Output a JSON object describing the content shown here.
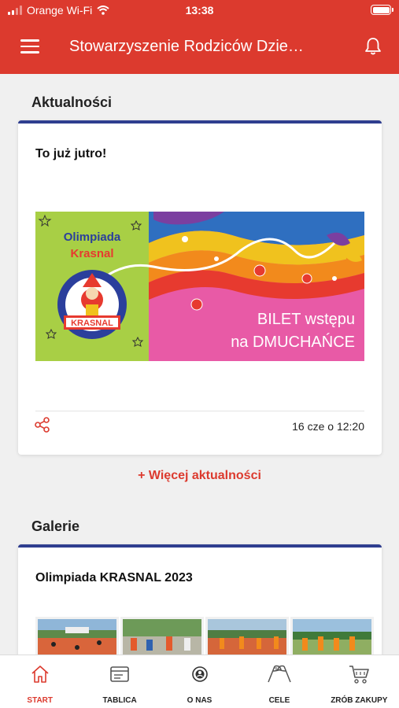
{
  "status_bar": {
    "carrier": "Orange Wi-Fi",
    "time": "13:38"
  },
  "app_bar": {
    "title": "Stowarzyszenie Rodziców Dzie…"
  },
  "news": {
    "section_title": "Aktualności",
    "post": {
      "title": "To już jutro!",
      "banner": {
        "line1": "Olimpiada",
        "line2": "Krasnal",
        "logo_text": "KRASNAL",
        "ticket_line1": "BILET wstępu",
        "ticket_line2": "na DMUCHAŃCE"
      },
      "date": "16 cze o 12:20"
    },
    "more_link": "+ Więcej aktualności"
  },
  "gallery": {
    "section_title": "Galerie",
    "album_title": "Olimpiada KRASNAL 2023",
    "thumbnail_count": 4
  },
  "tab_bar": {
    "tabs": [
      {
        "label": "START",
        "icon": "home-icon",
        "active": true
      },
      {
        "label": "TABLICA",
        "icon": "board-icon",
        "active": false
      },
      {
        "label": "O NAS",
        "icon": "about-icon",
        "active": false
      },
      {
        "label": "CELE",
        "icon": "flags-icon",
        "active": false
      },
      {
        "label": "ZRÓB ZAKUPY",
        "icon": "cart-icon",
        "active": false
      }
    ]
  },
  "colors": {
    "primary": "#dc3a2e",
    "card_accent": "#2f3e8f",
    "background": "#f0f0f0"
  }
}
